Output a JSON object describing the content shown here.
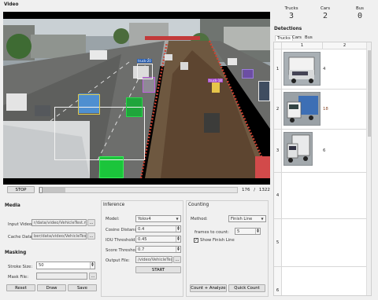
{
  "video": {
    "section_title": "Video",
    "stop_label": "STOP",
    "frame_current": "176",
    "frame_sep": "/",
    "frame_total": "1322",
    "progress_fraction": 0.133,
    "detection_labels": [
      "truck-20",
      "truck-18"
    ]
  },
  "counts": {
    "trucks_label": "Trucks",
    "trucks_value": "3",
    "cars_label": "Cars",
    "cars_value": "2",
    "bus_label": "Bus",
    "bus_value": "0"
  },
  "detections": {
    "title": "Detections",
    "tabs": [
      "Trucks",
      "Cars",
      "Bus"
    ],
    "columns": [
      "1",
      "2"
    ],
    "rows": [
      {
        "index": "1",
        "value": "4"
      },
      {
        "index": "2",
        "value": "18"
      },
      {
        "index": "3",
        "value": "6"
      },
      {
        "index": "4",
        "value": ""
      },
      {
        "index": "5",
        "value": ""
      },
      {
        "index": "6",
        "value": ""
      }
    ]
  },
  "media": {
    "title": "Media",
    "input_video_label": "Input Video:",
    "input_video_value": "r/data/video/VehicleTest.mp4",
    "cache_data_label": "Cache Data:",
    "cache_data_value": "ber/data/video/VehicleTest.h5",
    "browse_label": "..."
  },
  "masking": {
    "title": "Masking",
    "stroke_size_label": "Stroke Size:",
    "stroke_size_value": "50",
    "mask_file_label": "Mask File:",
    "mask_file_value": "",
    "reset_label": "Reset",
    "draw_label": "Draw",
    "save_label": "Save"
  },
  "inference": {
    "title": "Inference",
    "model_label": "Model:",
    "model_value": "Yolov4",
    "cosine_label": "Cosine Distance:",
    "cosine_value": "0.4",
    "iou_label": "IOU Threshold:",
    "iou_value": "0.45",
    "score_label": "Score Threshold",
    "score_value": "0.7",
    "output_label": "Output File:",
    "output_value": "/video/VehicleTest",
    "start_label": "START"
  },
  "counting": {
    "title": "Counting",
    "method_label": "Method:",
    "method_value": "Finish Line",
    "frames_label": "frames to count:",
    "frames_value": "5",
    "show_finish_label": "Show Finish Line",
    "show_finish_checked": true,
    "count_analyze_label": "Count + Analyze",
    "quick_count_label": "Quick Count"
  }
}
